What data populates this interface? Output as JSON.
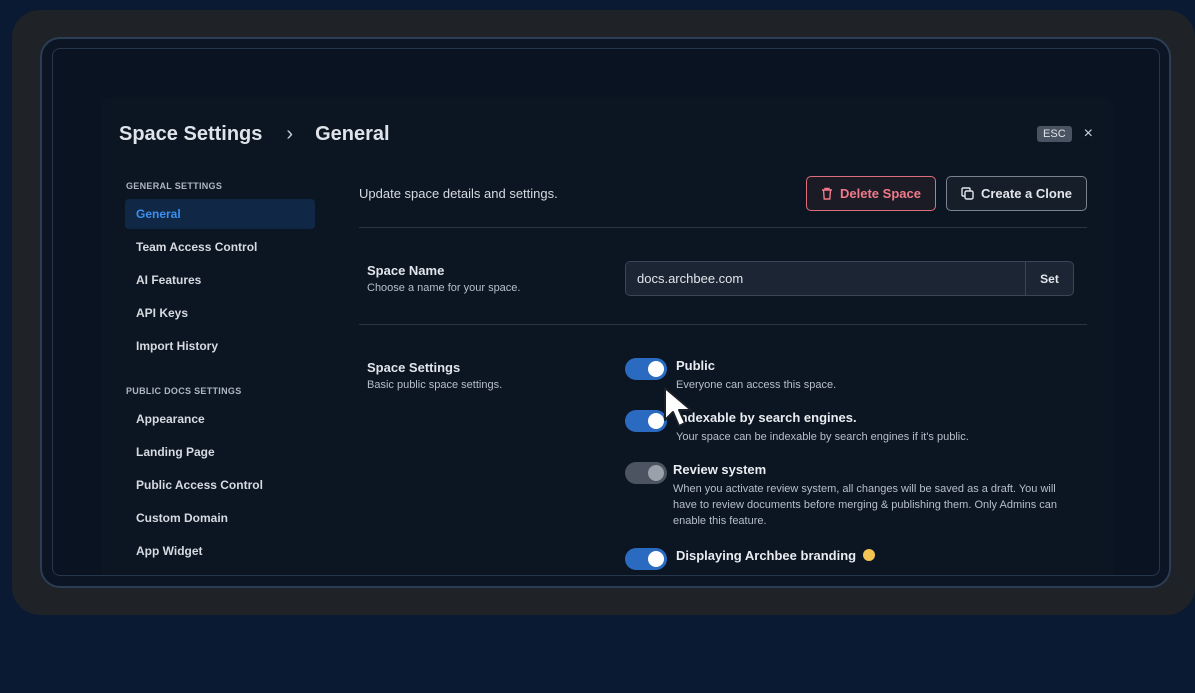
{
  "header": {
    "breadcrumb": [
      "Space Settings",
      "General"
    ],
    "separator": "›",
    "esc_label": "ESC",
    "close_glyph": "×"
  },
  "sidebar": {
    "general_heading": "GENERAL SETTINGS",
    "general_items": [
      {
        "label": "General",
        "active": true
      },
      {
        "label": "Team Access Control"
      },
      {
        "label": "AI Features"
      },
      {
        "label": "API Keys"
      },
      {
        "label": "Import History"
      }
    ],
    "public_heading": "PUBLIC DOCS SETTINGS",
    "public_items": [
      {
        "label": "Appearance"
      },
      {
        "label": "Landing Page"
      },
      {
        "label": "Public Access Control"
      },
      {
        "label": "Custom Domain"
      },
      {
        "label": "App Widget"
      }
    ]
  },
  "content": {
    "description": "Update space details and settings.",
    "delete_label": "Delete Space",
    "clone_label": "Create a Clone",
    "space_name": {
      "title": "Space Name",
      "subtitle": "Choose a name for your space.",
      "value": "docs.archbee.com",
      "set_label": "Set"
    },
    "space_settings": {
      "title": "Space Settings",
      "subtitle": "Basic public space settings.",
      "toggles": [
        {
          "title": "Public",
          "desc": "Everyone can access this space.",
          "on": true
        },
        {
          "title": "Indexable by search engines.",
          "desc": "Your space can be indexable by search engines if it's public.",
          "on": true
        },
        {
          "title": "Review system",
          "desc": "When you activate review system, all changes will be saved as a draft. You will have to review documents before merging & publishing them. Only Admins can enable this feature.",
          "on": false
        },
        {
          "title": "Displaying Archbee branding",
          "desc": "",
          "on": true,
          "emoji": true
        }
      ]
    }
  },
  "colors": {
    "accent": "#2a6bc1",
    "danger": "#f07a88",
    "background": "#0a1a33"
  }
}
